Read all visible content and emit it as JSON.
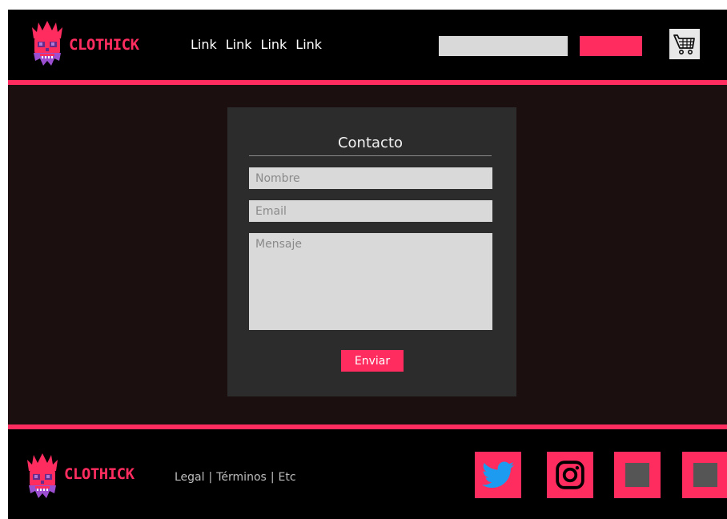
{
  "brand": {
    "name": "CLOTHICK",
    "accent_color": "#ff2d5f"
  },
  "header": {
    "nav_links": [
      "Link",
      "Link",
      "Link",
      "Link"
    ],
    "search": {
      "value": "",
      "placeholder": ""
    },
    "search_button_label": "",
    "cart_icon": "shopping-cart-icon"
  },
  "contact": {
    "title": "Contacto",
    "name_placeholder": "Nombre",
    "email_placeholder": "Email",
    "message_placeholder": "Mensaje",
    "send_label": "Enviar"
  },
  "footer": {
    "links": [
      "Legal",
      "Términos",
      "Etc"
    ],
    "separator": "|",
    "social": [
      "twitter-icon",
      "instagram-icon",
      "placeholder-icon",
      "placeholder-icon"
    ]
  },
  "colors": {
    "page_background": "#000000",
    "main_background": "#1c0f0f",
    "card_background": "#2c2c2c",
    "input_background": "#d9d9d9"
  }
}
